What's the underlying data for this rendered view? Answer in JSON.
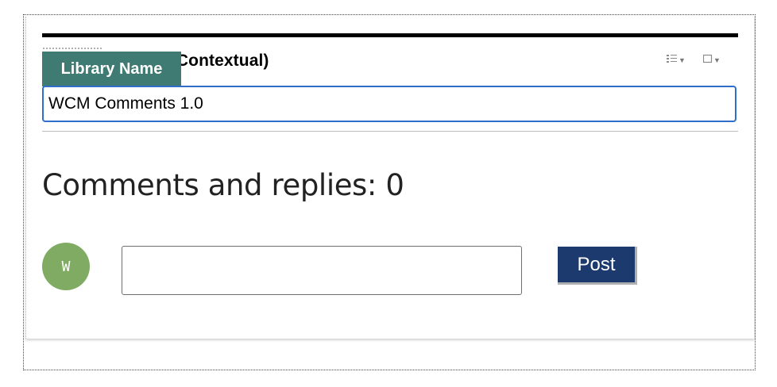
{
  "portlet": {
    "title": "Content Viewer (Contextual)",
    "tooltip": "Library Name"
  },
  "library_input": {
    "value": "WCM Comments 1.0"
  },
  "comments": {
    "heading": "Comments and replies: 0",
    "avatar_initial": "W",
    "comment_placeholder": "",
    "post_label": "Post"
  },
  "icons": {
    "edit": "edit-menu-icon",
    "portlet_menu": "portlet-menu-icon"
  },
  "colors": {
    "tooltip_bg": "#3f7b72",
    "input_focus_border": "#2f6fca",
    "avatar_bg": "#7fab63",
    "post_button_bg": "#1c3a6e"
  }
}
